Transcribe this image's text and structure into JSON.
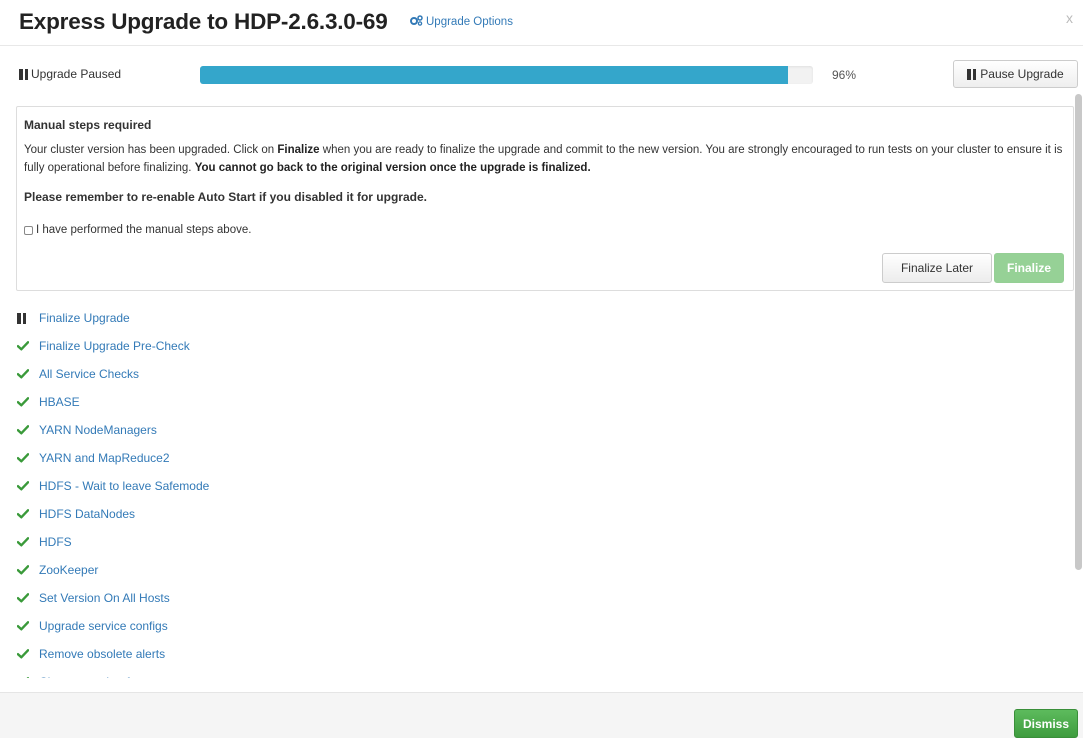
{
  "header": {
    "title": "Express Upgrade to HDP-2.6.3.0-69",
    "upgrade_options_label": "Upgrade Options",
    "close_label": "x"
  },
  "progress": {
    "status_label": "Upgrade Paused",
    "percent": 96,
    "percent_text": "96%",
    "pause_button_label": "Pause Upgrade",
    "bar_color": "#34a6cb"
  },
  "manual": {
    "title": "Manual steps required",
    "text_part1": "Your cluster version has been upgraded. Click on ",
    "text_bold1": "Finalize",
    "text_part2": " when you are ready to finalize the upgrade and commit to the new version. You are strongly encouraged to run tests on your cluster to ensure it is fully operational before finalizing. ",
    "text_bold2": "You cannot go back to the original version once the upgrade is finalized.",
    "reminder": "Please remember to re-enable Auto Start if you disabled it for upgrade.",
    "confirm_label": "I have performed the manual steps above.",
    "finalize_later_label": "Finalize Later",
    "finalize_label": "Finalize"
  },
  "items": [
    {
      "label": "Finalize Upgrade",
      "status": "paused"
    },
    {
      "label": "Finalize Upgrade Pre-Check",
      "status": "done"
    },
    {
      "label": "All Service Checks",
      "status": "done"
    },
    {
      "label": "HBASE",
      "status": "done"
    },
    {
      "label": "YARN NodeManagers",
      "status": "done"
    },
    {
      "label": "YARN and MapReduce2",
      "status": "done"
    },
    {
      "label": "HDFS - Wait to leave Safemode",
      "status": "done"
    },
    {
      "label": "HDFS DataNodes",
      "status": "done"
    },
    {
      "label": "HDFS",
      "status": "done"
    },
    {
      "label": "ZooKeeper",
      "status": "done"
    },
    {
      "label": "Set Version On All Hosts",
      "status": "done"
    },
    {
      "label": "Upgrade service configs",
      "status": "done"
    },
    {
      "label": "Remove obsolete alerts",
      "status": "done"
    },
    {
      "label": "Change stack references",
      "status": "done"
    }
  ],
  "footer": {
    "dismiss_label": "Dismiss"
  },
  "colors": {
    "link": "#337ab7",
    "check": "#3a9a3a",
    "finalize_disabled": "#96d196",
    "dismiss": "#4cae4c"
  }
}
